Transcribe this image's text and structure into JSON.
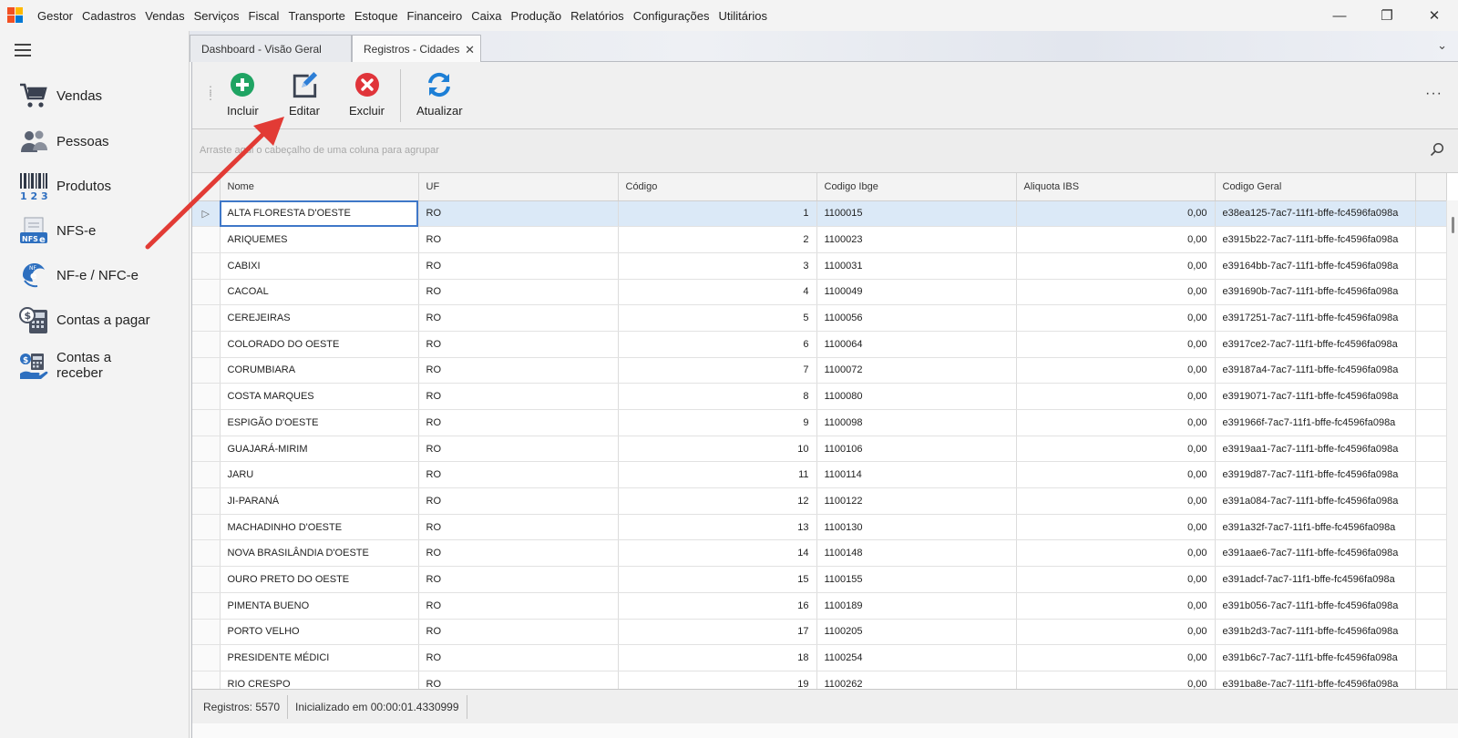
{
  "menu": {
    "items": [
      "Gestor",
      "Cadastros",
      "Vendas",
      "Serviços",
      "Fiscal",
      "Transporte",
      "Estoque",
      "Financeiro",
      "Caixa",
      "Produção",
      "Relatórios",
      "Configurações",
      "Utilitários"
    ]
  },
  "window_controls": {
    "minimize": "—",
    "restore": "❐",
    "close": "✕"
  },
  "sidebar": {
    "items": [
      {
        "label": "Vendas",
        "icon": "cart-icon"
      },
      {
        "label": "Pessoas",
        "icon": "people-icon"
      },
      {
        "label": "Produtos",
        "icon": "barcode-icon"
      },
      {
        "label": "NFS-e",
        "icon": "nfse-icon"
      },
      {
        "label": "NF-e / NFC-e",
        "icon": "nfe-icon"
      },
      {
        "label": "Contas a pagar",
        "icon": "bills-icon"
      },
      {
        "label": "Contas a receber",
        "icon": "receivables-icon"
      }
    ]
  },
  "tabs": [
    {
      "label": "Dashboard - Visão Geral"
    },
    {
      "label": "Registros - Cidades",
      "close": "✕"
    }
  ],
  "tab_overflow": "⌄",
  "toolbar": {
    "incluir": "Incluir",
    "editar": "Editar",
    "excluir": "Excluir",
    "atualizar": "Atualizar",
    "more": "···"
  },
  "group_panel": {
    "hint": "Arraste aqui o cabeçalho de uma coluna para agrupar"
  },
  "grid": {
    "columns": [
      "Nome",
      "UF",
      "Código",
      "Codigo Ibge",
      "Aliquota IBS",
      "Codigo Geral"
    ],
    "rows": [
      [
        "ALTA FLORESTA D'OESTE",
        "RO",
        "1",
        "1100015",
        "0,00",
        "e38ea125-7ac7-11f1-bffe-fc4596fa098a"
      ],
      [
        "ARIQUEMES",
        "RO",
        "2",
        "1100023",
        "0,00",
        "e3915b22-7ac7-11f1-bffe-fc4596fa098a"
      ],
      [
        "CABIXI",
        "RO",
        "3",
        "1100031",
        "0,00",
        "e39164bb-7ac7-11f1-bffe-fc4596fa098a"
      ],
      [
        "CACOAL",
        "RO",
        "4",
        "1100049",
        "0,00",
        "e391690b-7ac7-11f1-bffe-fc4596fa098a"
      ],
      [
        "CEREJEIRAS",
        "RO",
        "5",
        "1100056",
        "0,00",
        "e3917251-7ac7-11f1-bffe-fc4596fa098a"
      ],
      [
        "COLORADO DO OESTE",
        "RO",
        "6",
        "1100064",
        "0,00",
        "e3917ce2-7ac7-11f1-bffe-fc4596fa098a"
      ],
      [
        "CORUMBIARA",
        "RO",
        "7",
        "1100072",
        "0,00",
        "e39187a4-7ac7-11f1-bffe-fc4596fa098a"
      ],
      [
        "COSTA MARQUES",
        "RO",
        "8",
        "1100080",
        "0,00",
        "e3919071-7ac7-11f1-bffe-fc4596fa098a"
      ],
      [
        "ESPIGÃO D'OESTE",
        "RO",
        "9",
        "1100098",
        "0,00",
        "e391966f-7ac7-11f1-bffe-fc4596fa098a"
      ],
      [
        "GUAJARÁ-MIRIM",
        "RO",
        "10",
        "1100106",
        "0,00",
        "e3919aa1-7ac7-11f1-bffe-fc4596fa098a"
      ],
      [
        "JARU",
        "RO",
        "11",
        "1100114",
        "0,00",
        "e3919d87-7ac7-11f1-bffe-fc4596fa098a"
      ],
      [
        "JI-PARANÁ",
        "RO",
        "12",
        "1100122",
        "0,00",
        "e391a084-7ac7-11f1-bffe-fc4596fa098a"
      ],
      [
        "MACHADINHO D'OESTE",
        "RO",
        "13",
        "1100130",
        "0,00",
        "e391a32f-7ac7-11f1-bffe-fc4596fa098a"
      ],
      [
        "NOVA BRASILÂNDIA D'OESTE",
        "RO",
        "14",
        "1100148",
        "0,00",
        "e391aae6-7ac7-11f1-bffe-fc4596fa098a"
      ],
      [
        "OURO PRETO DO OESTE",
        "RO",
        "15",
        "1100155",
        "0,00",
        "e391adcf-7ac7-11f1-bffe-fc4596fa098a"
      ],
      [
        "PIMENTA BUENO",
        "RO",
        "16",
        "1100189",
        "0,00",
        "e391b056-7ac7-11f1-bffe-fc4596fa098a"
      ],
      [
        "PORTO VELHO",
        "RO",
        "17",
        "1100205",
        "0,00",
        "e391b2d3-7ac7-11f1-bffe-fc4596fa098a"
      ],
      [
        "PRESIDENTE MÉDICI",
        "RO",
        "18",
        "1100254",
        "0,00",
        "e391b6c7-7ac7-11f1-bffe-fc4596fa098a"
      ],
      [
        "RIO CRESPO",
        "RO",
        "19",
        "1100262",
        "0,00",
        "e391ba8e-7ac7-11f1-bffe-fc4596fa098a"
      ]
    ],
    "selected_row": 0,
    "row_indicator": "▷"
  },
  "status": {
    "records": "Registros: 5570",
    "init": "Inicializado em 00:00:01.4330999"
  },
  "colors": {
    "accent": "#3f78c8",
    "add": "#1fa463",
    "delete": "#e0343a",
    "refresh": "#1d7fd6",
    "arrow": "#e23b35",
    "selection": "#dbe9f7"
  }
}
